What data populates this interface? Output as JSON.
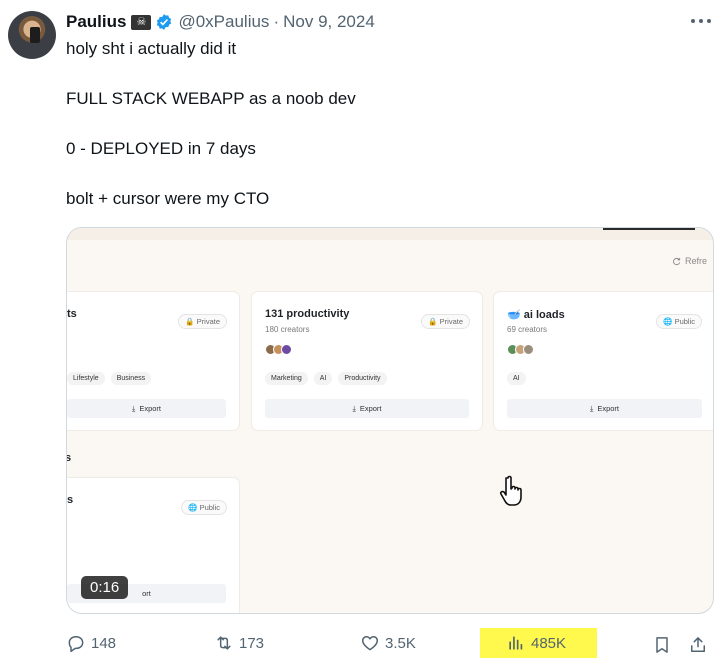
{
  "tweet": {
    "author_name": "Paulius",
    "author_emoji": "☠",
    "handle": "@0xPaulius",
    "separator": "·",
    "date": "Nov 9, 2024",
    "lines": [
      "holy sht i actually did it",
      "FULL STACK WEBAPP as a noob dev",
      "0 - DEPLOYED in 7 days",
      "bolt + cursor were my CTO"
    ]
  },
  "video": {
    "duration": "0:16",
    "refresh_label": "Refre",
    "cards": [
      {
        "title": "ts",
        "badge": "Private",
        "tags": [
          "Lifestyle",
          "Business"
        ],
        "export": "Export"
      },
      {
        "title": "131 productivity",
        "subtitle": "180 creators",
        "badge": "Private",
        "tags": [
          "Marketing",
          "AI",
          "Productivity"
        ],
        "export": "Export"
      },
      {
        "title": "ai loads",
        "subtitle": "69 creators",
        "badge": "Public",
        "tags": [
          "AI"
        ],
        "export": "Export"
      },
      {
        "title": "s",
        "badge": "Public",
        "export": "ort"
      }
    ],
    "section_letter": "s"
  },
  "actions": {
    "replies": "148",
    "reposts": "173",
    "likes": "3.5K",
    "views": "485K"
  },
  "colors": {
    "verified": "#1d9bf0",
    "muted": "#536471",
    "highlight": "#fff94d"
  }
}
